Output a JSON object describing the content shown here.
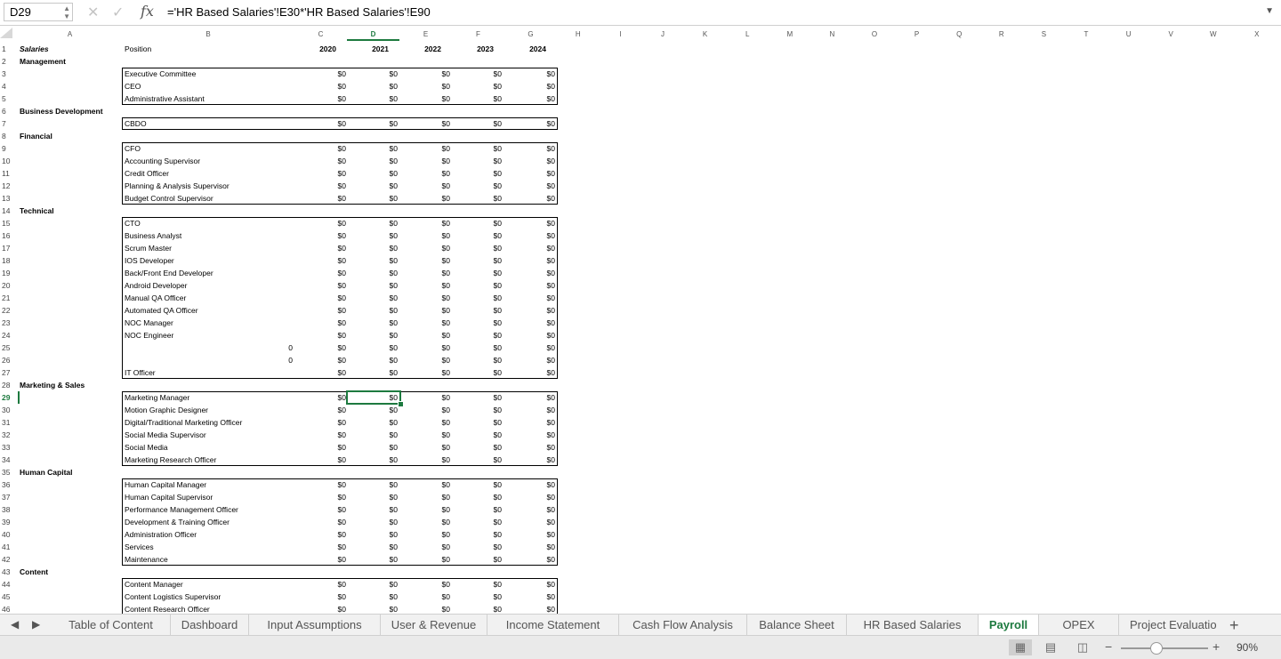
{
  "formula_bar": {
    "name_box": "D29",
    "cancel_icon": "close-icon",
    "enter_icon": "check-icon",
    "fx_label": "fx",
    "formula": "='HR Based Salaries'!E30*'HR Based Salaries'!E90"
  },
  "columns": [
    "A",
    "B",
    "C",
    "D",
    "E",
    "F",
    "G",
    "H",
    "I",
    "J",
    "K",
    "L",
    "M",
    "N",
    "O",
    "P",
    "Q",
    "R",
    "S",
    "T",
    "U",
    "V",
    "W",
    "X"
  ],
  "header": {
    "salaries": "Salaries",
    "position": "Position",
    "years": [
      "2020",
      "2021",
      "2022",
      "2023",
      "2024"
    ]
  },
  "sections": [
    {
      "row": 2,
      "label": "Management"
    },
    {
      "row": 6,
      "label": "Business Development"
    },
    {
      "row": 8,
      "label": "Financial"
    },
    {
      "row": 14,
      "label": "Technical"
    },
    {
      "row": 28,
      "label": "Marketing & Sales"
    },
    {
      "row": 35,
      "label": "Human Capital"
    },
    {
      "row": 43,
      "label": "Content"
    }
  ],
  "positions": [
    {
      "row": 3,
      "name": "Executive Committee"
    },
    {
      "row": 4,
      "name": "CEO"
    },
    {
      "row": 5,
      "name": "Administrative Assistant"
    },
    {
      "row": 7,
      "name": "CBDO"
    },
    {
      "row": 9,
      "name": "CFO"
    },
    {
      "row": 10,
      "name": "Accounting Supervisor"
    },
    {
      "row": 11,
      "name": "Credit Officer"
    },
    {
      "row": 12,
      "name": "Planning & Analysis Supervisor"
    },
    {
      "row": 13,
      "name": "Budget Control Supervisor"
    },
    {
      "row": 15,
      "name": "CTO"
    },
    {
      "row": 16,
      "name": "Business Analyst"
    },
    {
      "row": 17,
      "name": "Scrum Master"
    },
    {
      "row": 18,
      "name": "IOS Developer"
    },
    {
      "row": 19,
      "name": "Back/Front End Developer"
    },
    {
      "row": 20,
      "name": "Android Developer"
    },
    {
      "row": 21,
      "name": "Manual QA Officer"
    },
    {
      "row": 22,
      "name": "Automated QA Officer"
    },
    {
      "row": 23,
      "name": "NOC Manager"
    },
    {
      "row": 24,
      "name": "NOC Engineer"
    },
    {
      "row": 25,
      "name": "",
      "b_value": "0"
    },
    {
      "row": 26,
      "name": "",
      "b_value": "0"
    },
    {
      "row": 27,
      "name": "IT Officer"
    },
    {
      "row": 29,
      "name": "Marketing Manager"
    },
    {
      "row": 30,
      "name": "Motion Graphic Designer"
    },
    {
      "row": 31,
      "name": "Digital/Traditional Marketing Officer"
    },
    {
      "row": 32,
      "name": "Social Media Supervisor"
    },
    {
      "row": 33,
      "name": "Social Media"
    },
    {
      "row": 34,
      "name": "Marketing Research Officer"
    },
    {
      "row": 36,
      "name": "Human Capital Manager"
    },
    {
      "row": 37,
      "name": "Human Capital Supervisor"
    },
    {
      "row": 38,
      "name": "Performance Management Officer"
    },
    {
      "row": 39,
      "name": "Development & Training Officer"
    },
    {
      "row": 40,
      "name": "Administration Officer"
    },
    {
      "row": 41,
      "name": "Services"
    },
    {
      "row": 42,
      "name": "Maintenance"
    },
    {
      "row": 44,
      "name": "Content Manager"
    },
    {
      "row": 45,
      "name": "Content Logistics Supervisor"
    },
    {
      "row": 46,
      "name": "Content Research Officer"
    }
  ],
  "cell_value": "$0",
  "groups": [
    {
      "first": 3,
      "last": 5
    },
    {
      "first": 7,
      "last": 7
    },
    {
      "first": 9,
      "last": 13
    },
    {
      "first": 15,
      "last": 27
    },
    {
      "first": 29,
      "last": 34
    },
    {
      "first": 36,
      "last": 42
    },
    {
      "first": 44,
      "last": 46
    }
  ],
  "active_cell": {
    "row": 29,
    "col": "D"
  },
  "tabs": [
    {
      "label": "Table of Content",
      "active": false
    },
    {
      "label": "Dashboard",
      "active": false
    },
    {
      "label": "Input Assumptions",
      "active": false
    },
    {
      "label": "User & Revenue",
      "active": false
    },
    {
      "label": "Income Statement",
      "active": false
    },
    {
      "label": "Cash Flow Analysis",
      "active": false
    },
    {
      "label": "Balance Sheet",
      "active": false
    },
    {
      "label": "HR Based Salaries",
      "active": false
    },
    {
      "label": "Payroll",
      "active": true
    },
    {
      "label": "OPEX",
      "active": false
    },
    {
      "label": "Project Evaluatio",
      "active": false
    }
  ],
  "status": {
    "zoom": "90%",
    "zoom_fraction": 0.4
  }
}
